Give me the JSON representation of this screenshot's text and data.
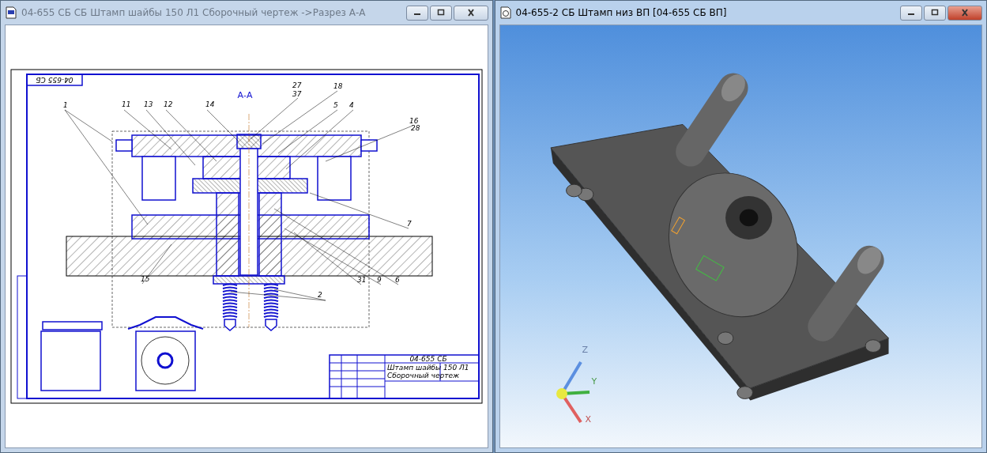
{
  "windows": [
    {
      "kind": "drawing",
      "title": "04-655 СБ СБ Штамп шайбы 150 Л1 Сборочный чертеж  ->Разрез А-А",
      "active": false,
      "drawing": {
        "stamp": "04-655 СБ",
        "section_label": "А-А",
        "callouts": [
          "1",
          "11",
          "13",
          "12",
          "14",
          "27",
          "37",
          "18",
          "5",
          "4",
          "16",
          "28",
          "7",
          "15",
          "31",
          "9",
          "6",
          "2"
        ],
        "title_block": {
          "designation": "04-655 СБ",
          "name": "Штамп шайбы 150 Л1",
          "doc_type": "Сборочный чертеж"
        }
      }
    },
    {
      "kind": "model",
      "title": "04-655-2 СБ Штамп низ ВП  [04-655 СБ ВП]",
      "active": true,
      "axes": [
        "Z",
        "Y",
        "X"
      ]
    }
  ]
}
